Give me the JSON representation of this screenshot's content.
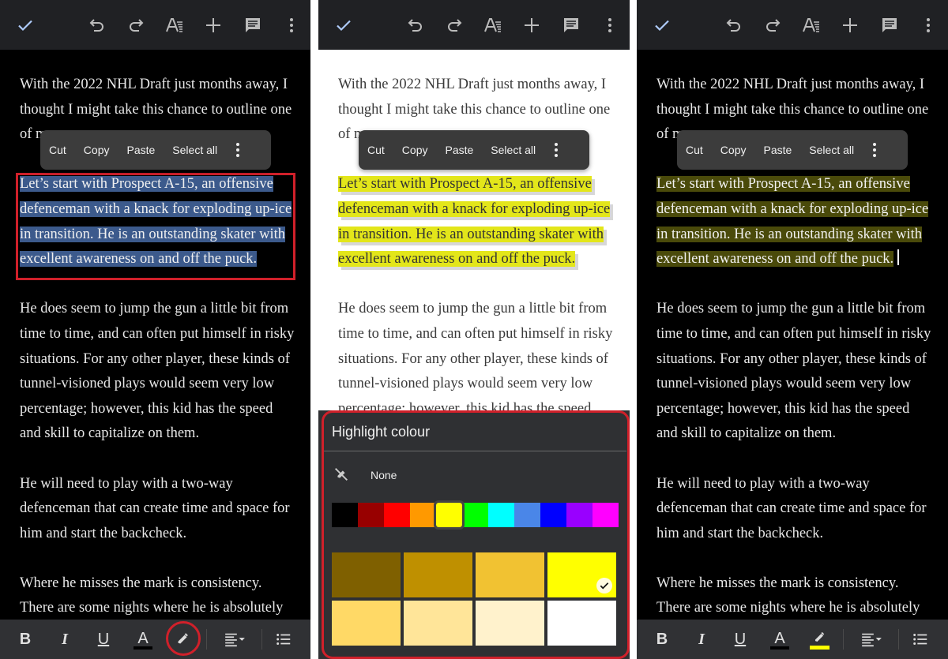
{
  "toolbar_top": {
    "icons": [
      "check-icon",
      "undo-icon",
      "redo-icon",
      "text-format-icon",
      "insert-plus-icon",
      "comment-icon",
      "more-vert-icon"
    ]
  },
  "context_menu": {
    "cut": "Cut",
    "copy": "Copy",
    "paste": "Paste",
    "select_all": "Select all",
    "more": "more-options-icon"
  },
  "document": {
    "para1_lines": [
      "With the 2022 NHL Draft just months away, I",
      "thought I might take this chance to outline one",
      "of m"
    ],
    "para2_lines": [
      "Let’s start with Prospect A-15, an offensive",
      "defenceman with a knack for exploding up-ice",
      "in transition. He is an outstanding skater with",
      "excellent awareness on and off the puck."
    ],
    "para3_lines": [
      "He does seem to jump the gun a little bit from",
      "time to time, and can often put himself in risky",
      "situations. For any other player, these kinds of",
      "tunnel-visioned plays would seem very low",
      "percentage; however, this kid has the speed",
      "and skill to capitalize on them."
    ],
    "para4_lines": [
      "He will need to play with a two-way",
      "defenceman that can create time and space for",
      "him and start the backcheck."
    ],
    "para5_lines": [
      "Where he misses the mark is consistency.",
      "There are some nights where he is absolutely"
    ]
  },
  "bottom_toolbar": {
    "bold": "B",
    "italic": "I",
    "underline": "U",
    "text_color": "A",
    "text_color_swatch": "#000000",
    "highlight_swatch_after": "#ffff00"
  },
  "highlight_sheet": {
    "title": "Highlight colour",
    "none_label": "None",
    "hues": [
      "#000000",
      "#980000",
      "#ff0000",
      "#ff9900",
      "#ffff00",
      "#00ff00",
      "#00ffff",
      "#4a86e8",
      "#0000ff",
      "#9900ff",
      "#ff00ff"
    ],
    "selected_hue": "#ffff00",
    "tones": [
      "#7f6000",
      "#bf9000",
      "#f1c232",
      "#ffff00",
      "#ffd966",
      "#ffe599",
      "#fff2cc",
      "#ffffff"
    ],
    "selected_tone": "#ffff00"
  },
  "colors": {
    "selection_blue": "#3c5a8c",
    "highlight_yellow": "#e3e61a",
    "highlight_dark_mode": "#4a4a0a",
    "annotation_red": "#d0202a"
  }
}
